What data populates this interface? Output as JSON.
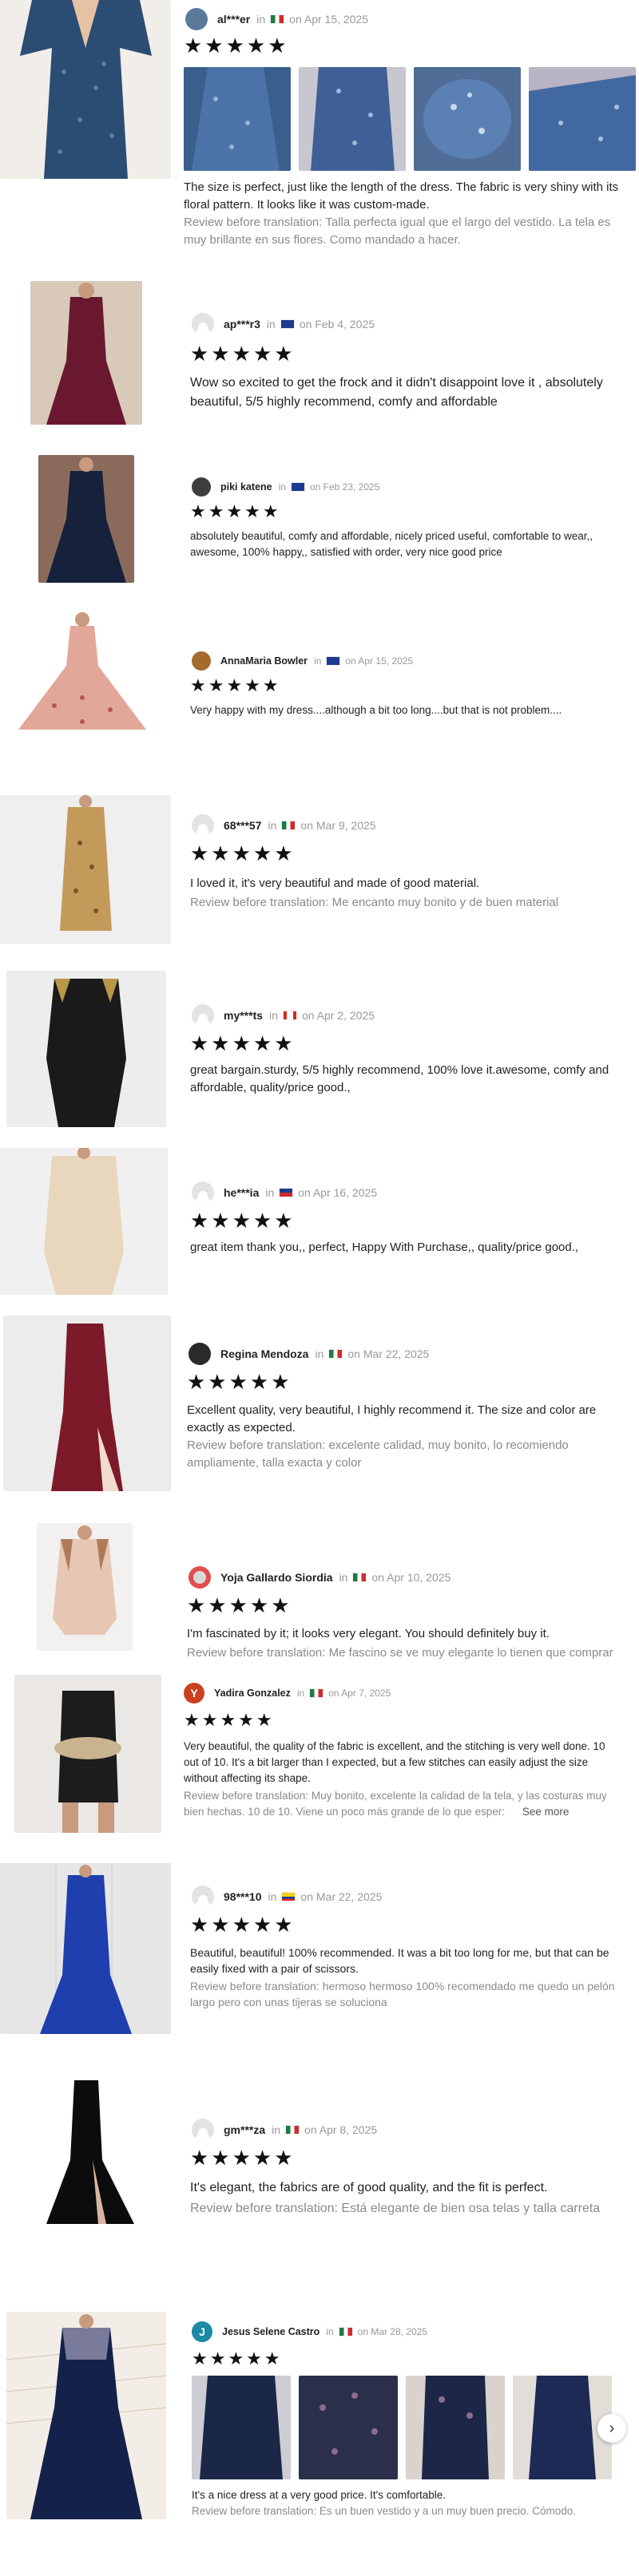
{
  "reviews": [
    {
      "user": "al***er",
      "country": "mx",
      "date": "on Apr 15, 2025",
      "stars": "★★★★★",
      "text": "The size is perfect, just like the length of the dress. The fabric is very shiny with its floral pattern. It looks like it was custom-made.",
      "original": "Review before translation: Talla perfecta igual que el largo del vestido. La tela es muy brillante en sus flores. Como mandado a hacer."
    },
    {
      "user": "ap***r3",
      "country": "au",
      "date": "on Feb 4, 2025",
      "stars": "★★★★★",
      "text": "Wow so excited to get the frock and it didn't disappoint love it , absolutely beautiful, 5/5 highly recommend, comfy and affordable"
    },
    {
      "user": "piki katene",
      "country": "au",
      "date": "on Feb 23, 2025",
      "stars": "★★★★★",
      "text": "absolutely beautiful, comfy and affordable, nicely priced useful, comfortable to wear,, awesome, 100% happy,, satisfied with order, very nice good price"
    },
    {
      "user": "AnnaMaria Bowler",
      "country": "au",
      "date": "on Apr 15, 2025",
      "stars": "★★★★★",
      "text": "Very happy with my dress....although a bit too long....but that is not problem...."
    },
    {
      "user": "68***57",
      "country": "mx",
      "date": "on Mar 9, 2025",
      "stars": "★★★★★",
      "text": "I loved it, it's very beautiful and made of good material.",
      "original": "Review before translation: Me encanto muy bonito y de buen material"
    },
    {
      "user": "my***ts",
      "country": "ca",
      "date": "on Apr 2, 2025",
      "stars": "★★★★★",
      "text": "great bargain.sturdy, 5/5 highly recommend, 100% love it.awesome, comfy and affordable, quality/price good.,"
    },
    {
      "user": "he***ia",
      "country": "ph",
      "date": "on Apr 16, 2025",
      "stars": "★★★★★",
      "text": "great item thank you,, perfect, Happy With Purchase,, quality/price good.,"
    },
    {
      "user": "Regina Mendoza",
      "country": "mx",
      "date": "on Mar 22, 2025",
      "stars": "★★★★★",
      "text": "Excellent quality, very beautiful, I highly recommend it. The size and color are exactly as expected.",
      "original": "Review before translation: excelente calidad, muy bonito, lo recomiendo ampliamente, talla exacta y color"
    },
    {
      "user": "Yoja Gallardo Siordia",
      "country": "mx",
      "date": "on Apr 10, 2025",
      "stars": "★★★★★",
      "text": "I'm fascinated by it; it looks very elegant. You should definitely buy it.",
      "original": "Review before translation: Me fascino se ve muy elegante lo tienen que comprar"
    },
    {
      "user": "Yadira Gonzalez",
      "avatar_letter": "Y",
      "country": "mx",
      "date": "on Apr 7, 2025",
      "stars": "★★★★★",
      "text": "Very beautiful, the quality of the fabric is excellent, and the stitching is very well done. 10 out of 10. It's a bit larger than I expected, but a few stitches can easily adjust the size without affecting its shape.",
      "original": "Review before translation: Muy bonito, excelente la calidad de la tela, y las costuras muy bien hechas. 10 de 10. Viene un poco más grande de lo que esper:",
      "see_more": "See more"
    },
    {
      "user": "98***10",
      "country": "ec",
      "date": "on Mar 22, 2025",
      "stars": "★★★★★",
      "text": "Beautiful, beautiful! 100% recommended. It was a bit too long for me, but that can be easily fixed with a pair of scissors.",
      "original": "Review before translation: hermoso hermoso 100% recomendado me quedo un pelón largo pero con unas tijeras se soluciona"
    },
    {
      "user": "gm***za",
      "country": "mx",
      "date": "on Apr 8, 2025",
      "stars": "★★★★★",
      "text": "It's elegant, the fabrics are of good quality, and the fit is perfect.",
      "original": "Review before translation: Está elegante de bien osa telas y talla carreta"
    },
    {
      "user": "Jesus Selene Castro",
      "avatar_letter": "J",
      "country": "mx",
      "date": "on Mar 28, 2025",
      "stars": "★★★★★",
      "text": "It's a nice dress at a very good price. It's comfortable.",
      "original": "Review before translation: Es un buen vestido y a un muy buen precio. Cómodo."
    }
  ],
  "icons": {
    "next": "chevron-right-icon",
    "star": "star-icon",
    "flag": "flag-icon",
    "avatar": "avatar-icon"
  }
}
